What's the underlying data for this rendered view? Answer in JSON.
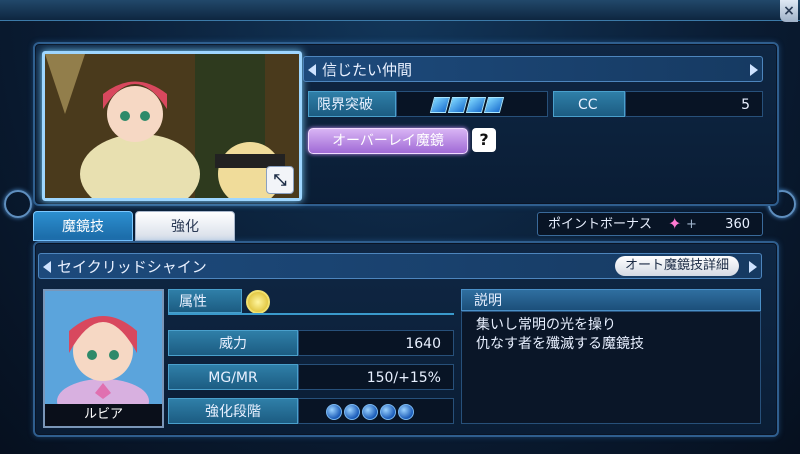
{
  "window": {
    "close_glyph": "×"
  },
  "hero": {
    "title": "信じたい仲間",
    "limit_break_label": "限界突破",
    "limit_break_gems": 4,
    "cc_label": "CC",
    "cc_value": "5",
    "overlay_button": "オーバーレイ魔鏡",
    "help_glyph": "?"
  },
  "tabs": [
    {
      "label": "魔鏡技",
      "active": true
    },
    {
      "label": "強化",
      "active": false
    }
  ],
  "bonus": {
    "label": "ポイントボーナス",
    "plus": "+",
    "value": "360"
  },
  "skill": {
    "name": "セイクリッドシャイン",
    "auto_detail_button": "オート魔鏡技詳細",
    "character_name": "ルビア",
    "attribute_label": "属性",
    "attribute_icon": "light-element-icon",
    "power_label": "威力",
    "power_value": "1640",
    "mgmr_label": "MG/MR",
    "mgmr_value": "150/+15%",
    "enhance_label": "強化段階",
    "enhance_orbs": 5,
    "desc_label": "説明",
    "desc_line1": "集いし常明の光を操り",
    "desc_line2": "仇なす者を殲滅する魔鏡技"
  },
  "colors": {
    "accent": "#2f7fa8",
    "overlay": "#b88ae6",
    "panel_border": "#2f5e8e"
  }
}
